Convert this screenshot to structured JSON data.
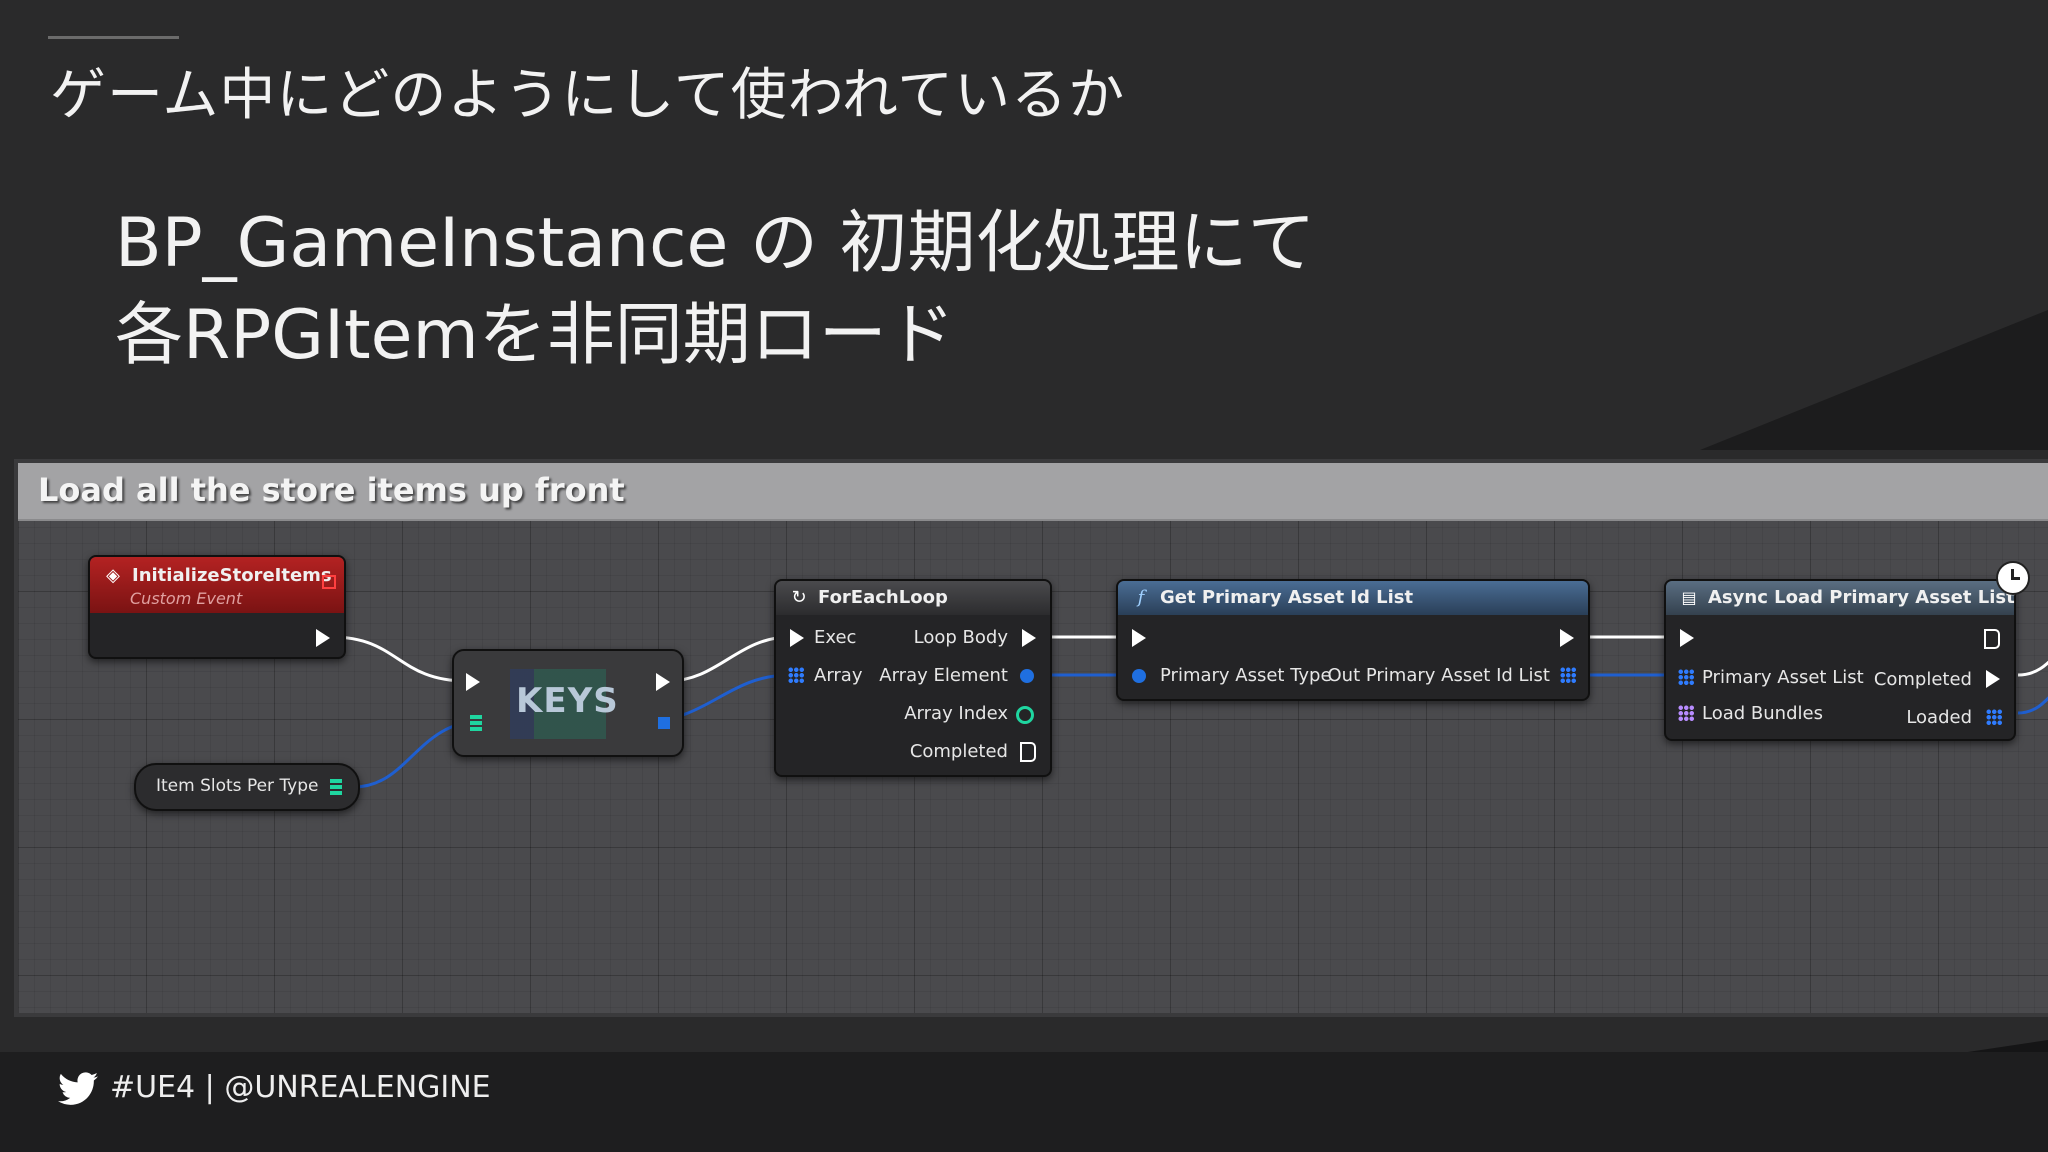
{
  "slide": {
    "heading": "ゲーム中にどのようにして使われているか",
    "body_line1": "BP_GameInstance の 初期化処理にて",
    "body_line2": "各RPGItemを非同期ロード"
  },
  "comment": {
    "title": "Load all the store items up front"
  },
  "nodes": {
    "custom_event": {
      "title": "InitializeStoreItems",
      "subtitle": "Custom Event",
      "icon": "event-diamond-icon",
      "color": "#9a1c1c"
    },
    "variable": {
      "label": "Item Slots Per Type"
    },
    "keys": {
      "label": "KEYS"
    },
    "for_each": {
      "title": "ForEachLoop",
      "icon": "loop-icon",
      "pins_in": [
        "Exec",
        "Array"
      ],
      "pins_out": [
        "Loop Body",
        "Array Element",
        "Array Index",
        "Completed"
      ]
    },
    "get_list": {
      "title": "Get Primary Asset Id List",
      "icon": "function-icon",
      "pin_in": "Primary Asset Type",
      "pin_out": "Out Primary Asset Id List",
      "color": "#3c5a7a"
    },
    "async_load": {
      "title": "Async Load Primary Asset List",
      "icon": "macro-icon",
      "pins_in": [
        "Primary Asset List",
        "Load Bundles"
      ],
      "pins_out": [
        "Completed",
        "Loaded"
      ],
      "color": "#4a5e70"
    }
  },
  "footer": {
    "text": "#UE4 | @UNREALENGINE",
    "icon": "twitter-bird-icon"
  }
}
